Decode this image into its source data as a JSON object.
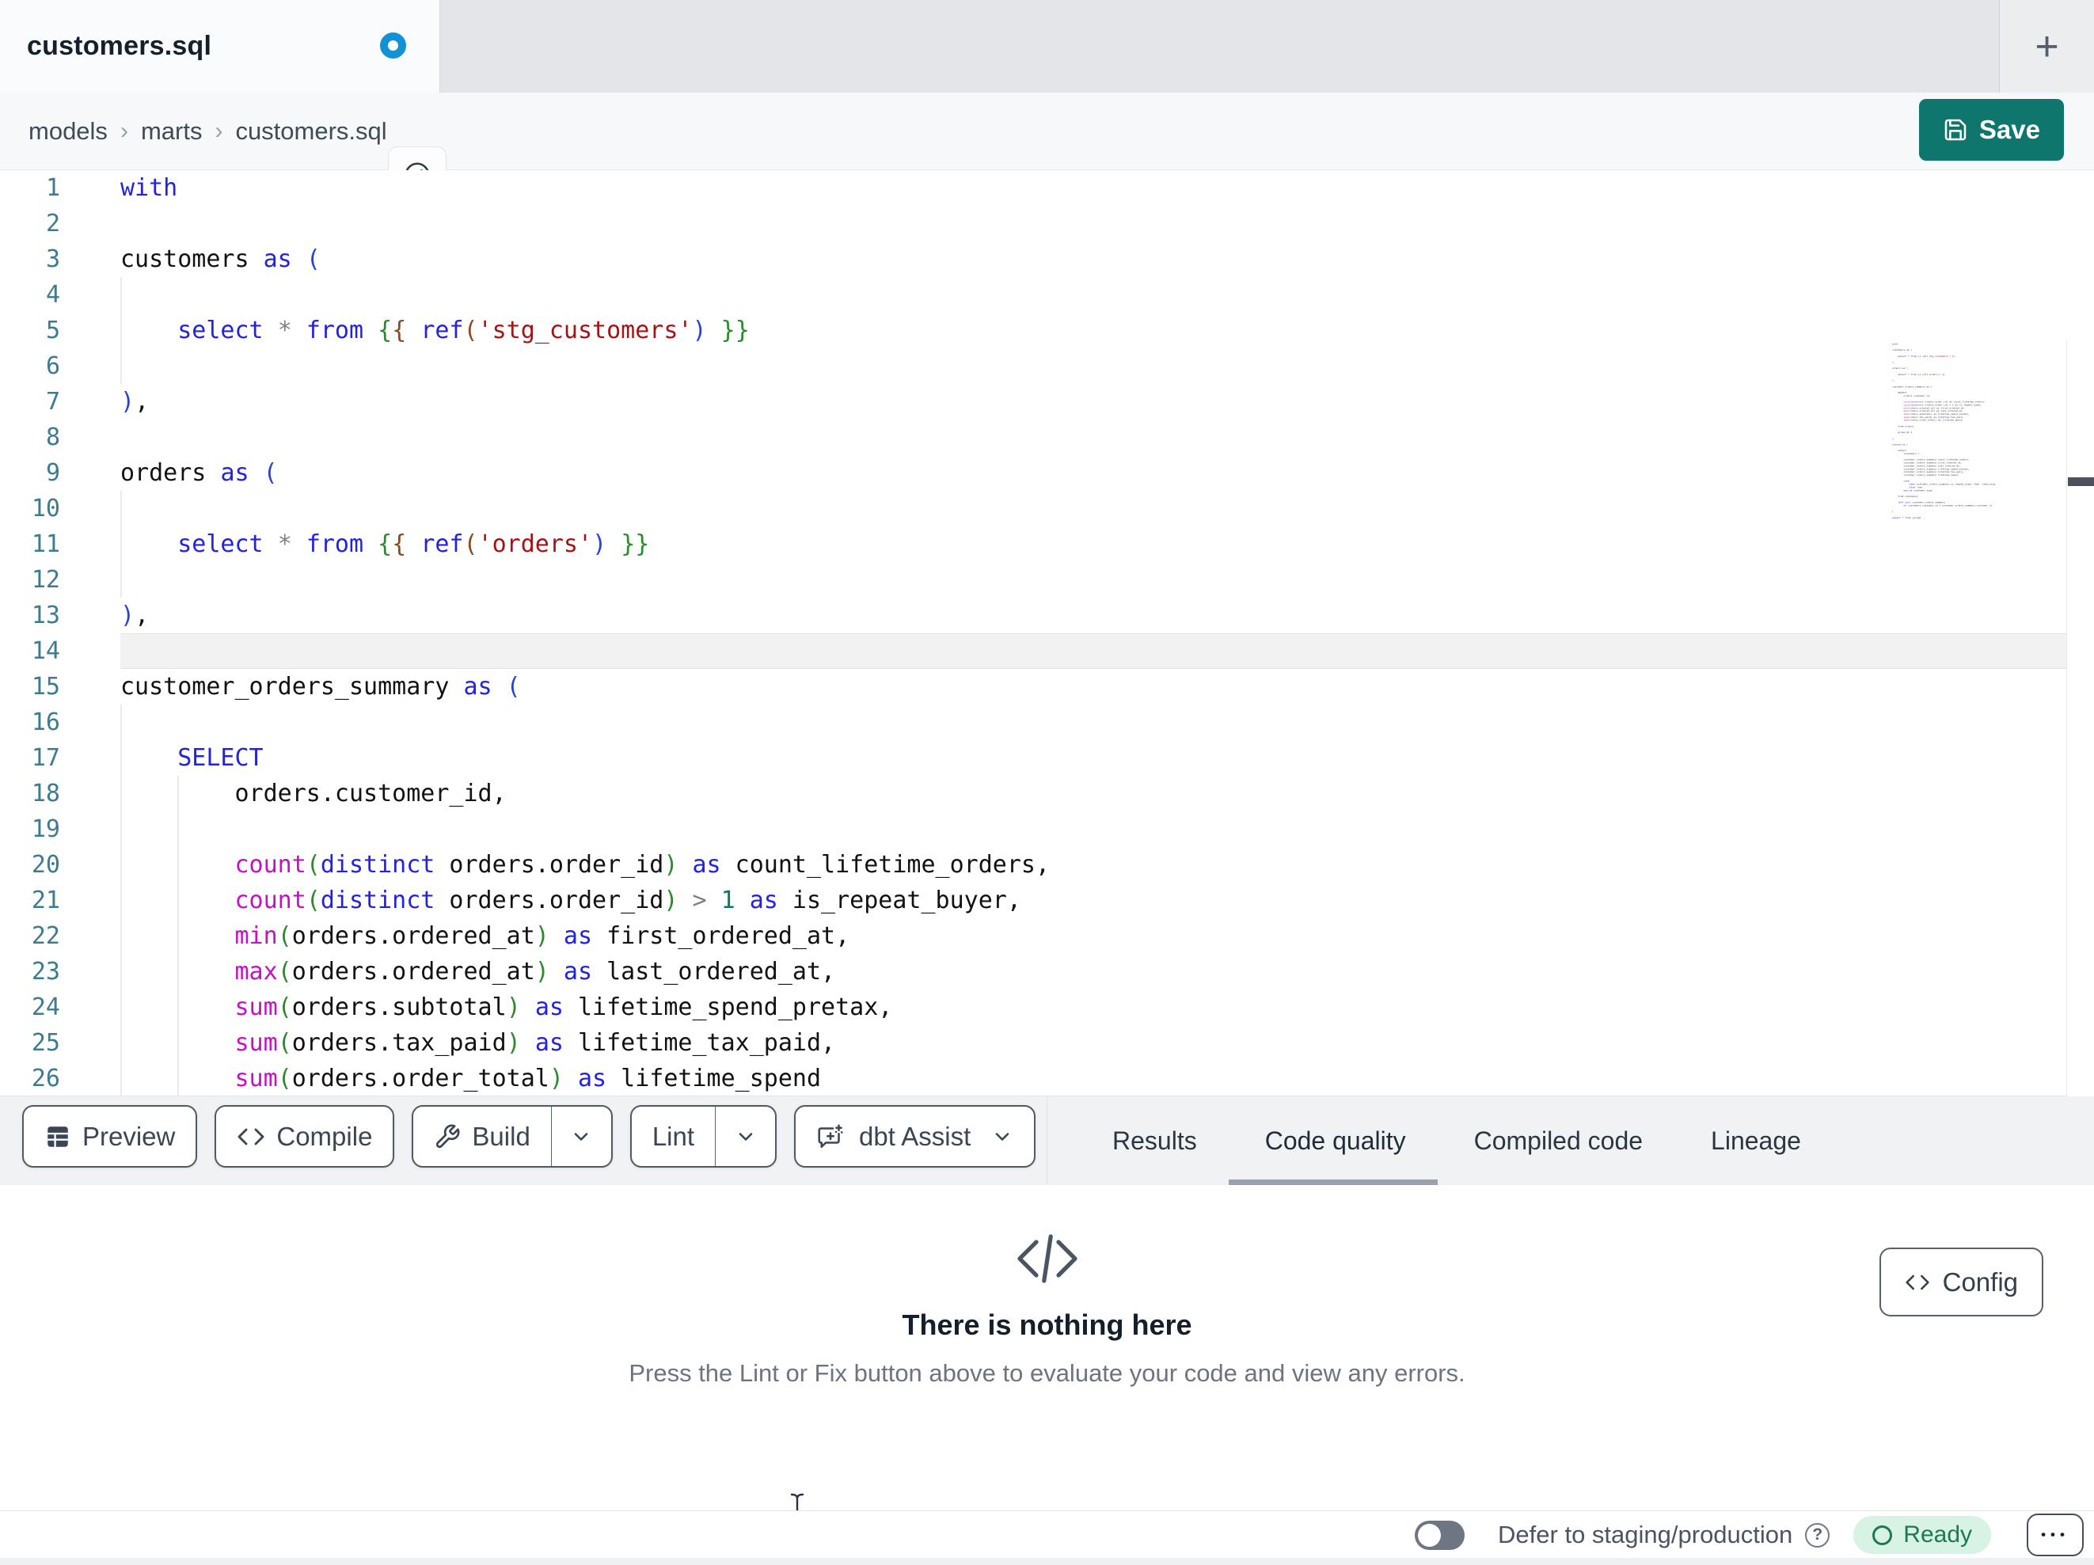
{
  "tab": {
    "title": "customers.sql",
    "new_tab_label": "+"
  },
  "breadcrumb": {
    "items": [
      "models",
      "marts",
      "customers.sql"
    ],
    "separator": "›"
  },
  "save": {
    "label": "Save"
  },
  "colors": {
    "brand_teal": "#0e766c",
    "dirty_dot_blue": "#1292d4",
    "ready_green": "#1b7a50",
    "ready_badge_bg": "#d8f2e4",
    "active_tab_underline": "#9aa1ab",
    "line_number_teal": "#3d7b8f",
    "keyword_blue": "#2323dd",
    "function_magenta": "#c511c5",
    "string_red": "#a31515"
  },
  "icons": {
    "tab_dirty": "unsaved-dot",
    "breadcrumb_action": "compass-icon",
    "save": "floppy-disk-icon",
    "preview": "table-icon",
    "compile": "code-icon",
    "build": "wrench-icon",
    "assist": "chat-plus-sparkle-icon",
    "dropdown": "chevron-down-icon",
    "empty_state": "code-icon",
    "config": "code-icon",
    "help": "question-circle-icon",
    "menu": "ellipsis-icon",
    "mouse": "text-cursor-icon"
  },
  "editor": {
    "active_line": 14,
    "lines": [
      {
        "n": "1",
        "g": [],
        "tk": [
          [
            "with",
            "kw"
          ]
        ]
      },
      {
        "n": "2",
        "g": [],
        "tk": []
      },
      {
        "n": "3",
        "g": [],
        "tk": [
          [
            "customers ",
            ""
          ],
          [
            "as",
            "kw"
          ],
          [
            " ",
            ""
          ],
          [
            "(",
            "lk"
          ]
        ]
      },
      {
        "n": "4",
        "g": [
          0
        ],
        "tk": []
      },
      {
        "n": "5",
        "g": [
          0
        ],
        "tk": [
          [
            "    ",
            ""
          ],
          [
            "select",
            "kw"
          ],
          [
            " ",
            ""
          ],
          [
            "*",
            "op"
          ],
          [
            " ",
            ""
          ],
          [
            "from",
            "kw"
          ],
          [
            " ",
            ""
          ],
          [
            "{",
            "gk"
          ],
          [
            "{",
            "bk"
          ],
          [
            " ",
            ""
          ],
          [
            "ref",
            "kw"
          ],
          [
            "(",
            "bk"
          ],
          [
            "'stg_customers'",
            "str"
          ],
          [
            ")",
            "lk"
          ],
          [
            " ",
            ""
          ],
          [
            "}",
            "gk"
          ],
          [
            "}",
            "gk"
          ]
        ]
      },
      {
        "n": "6",
        "g": [
          0
        ],
        "tk": []
      },
      {
        "n": "7",
        "g": [],
        "tk": [
          [
            ")",
            "lk"
          ],
          [
            ",",
            ""
          ]
        ]
      },
      {
        "n": "8",
        "g": [],
        "tk": []
      },
      {
        "n": "9",
        "g": [],
        "tk": [
          [
            "orders ",
            ""
          ],
          [
            "as",
            "kw"
          ],
          [
            " ",
            ""
          ],
          [
            "(",
            "lk"
          ]
        ]
      },
      {
        "n": "10",
        "g": [
          0
        ],
        "tk": []
      },
      {
        "n": "11",
        "g": [
          0
        ],
        "tk": [
          [
            "    ",
            ""
          ],
          [
            "select",
            "kw"
          ],
          [
            " ",
            ""
          ],
          [
            "*",
            "op"
          ],
          [
            " ",
            ""
          ],
          [
            "from",
            "kw"
          ],
          [
            " ",
            ""
          ],
          [
            "{",
            "gk"
          ],
          [
            "{",
            "bk"
          ],
          [
            " ",
            ""
          ],
          [
            "ref",
            "kw"
          ],
          [
            "(",
            "bk"
          ],
          [
            "'orders'",
            "str"
          ],
          [
            ")",
            "lk"
          ],
          [
            " ",
            ""
          ],
          [
            "}",
            "gk"
          ],
          [
            "}",
            "gk"
          ]
        ]
      },
      {
        "n": "12",
        "g": [
          0
        ],
        "tk": []
      },
      {
        "n": "13",
        "g": [],
        "tk": [
          [
            ")",
            "lk"
          ],
          [
            ",",
            ""
          ]
        ]
      },
      {
        "n": "14",
        "g": [],
        "tk": []
      },
      {
        "n": "15",
        "g": [],
        "tk": [
          [
            "customer_orders_summary ",
            ""
          ],
          [
            "as",
            "kw"
          ],
          [
            " ",
            ""
          ],
          [
            "(",
            "lk"
          ]
        ]
      },
      {
        "n": "16",
        "g": [
          0
        ],
        "tk": []
      },
      {
        "n": "17",
        "g": [
          0
        ],
        "tk": [
          [
            "    ",
            ""
          ],
          [
            "SELECT",
            "kw"
          ]
        ]
      },
      {
        "n": "18",
        "g": [
          0,
          4
        ],
        "tk": [
          [
            "        orders.customer_id,",
            ""
          ]
        ]
      },
      {
        "n": "19",
        "g": [
          0,
          4
        ],
        "tk": []
      },
      {
        "n": "20",
        "g": [
          0,
          4
        ],
        "tk": [
          [
            "        ",
            ""
          ],
          [
            "count",
            "fn"
          ],
          [
            "(",
            "gk"
          ],
          [
            "distinct",
            "kw"
          ],
          [
            " orders.order_id",
            ""
          ],
          [
            ")",
            "gk"
          ],
          [
            " ",
            ""
          ],
          [
            "as",
            "kw"
          ],
          [
            " count_lifetime_orders,",
            ""
          ]
        ]
      },
      {
        "n": "21",
        "g": [
          0,
          4
        ],
        "tk": [
          [
            "        ",
            ""
          ],
          [
            "count",
            "fn"
          ],
          [
            "(",
            "gk"
          ],
          [
            "distinct",
            "kw"
          ],
          [
            " orders.order_id",
            ""
          ],
          [
            ")",
            "gk"
          ],
          [
            " ",
            ""
          ],
          [
            ">",
            "op"
          ],
          [
            " ",
            ""
          ],
          [
            "1",
            "num"
          ],
          [
            " ",
            ""
          ],
          [
            "as",
            "kw"
          ],
          [
            " is_repeat_buyer,",
            ""
          ]
        ]
      },
      {
        "n": "22",
        "g": [
          0,
          4
        ],
        "tk": [
          [
            "        ",
            ""
          ],
          [
            "min",
            "fn"
          ],
          [
            "(",
            "gk"
          ],
          [
            "orders.ordered_at",
            ""
          ],
          [
            ")",
            "gk"
          ],
          [
            " ",
            ""
          ],
          [
            "as",
            "kw"
          ],
          [
            " first_ordered_at,",
            ""
          ]
        ]
      },
      {
        "n": "23",
        "g": [
          0,
          4
        ],
        "tk": [
          [
            "        ",
            ""
          ],
          [
            "max",
            "fn"
          ],
          [
            "(",
            "gk"
          ],
          [
            "orders.ordered_at",
            ""
          ],
          [
            ")",
            "gk"
          ],
          [
            " ",
            ""
          ],
          [
            "as",
            "kw"
          ],
          [
            " last_ordered_at,",
            ""
          ]
        ]
      },
      {
        "n": "24",
        "g": [
          0,
          4
        ],
        "tk": [
          [
            "        ",
            ""
          ],
          [
            "sum",
            "fn"
          ],
          [
            "(",
            "gk"
          ],
          [
            "orders.subtotal",
            ""
          ],
          [
            ")",
            "gk"
          ],
          [
            " ",
            ""
          ],
          [
            "as",
            "kw"
          ],
          [
            " lifetime_spend_pretax,",
            ""
          ]
        ]
      },
      {
        "n": "25",
        "g": [
          0,
          4
        ],
        "tk": [
          [
            "        ",
            ""
          ],
          [
            "sum",
            "fn"
          ],
          [
            "(",
            "gk"
          ],
          [
            "orders.tax_paid",
            ""
          ],
          [
            ")",
            "gk"
          ],
          [
            " ",
            ""
          ],
          [
            "as",
            "kw"
          ],
          [
            " lifetime_tax_paid,",
            ""
          ]
        ]
      },
      {
        "n": "26",
        "g": [
          0,
          4
        ],
        "tk": [
          [
            "        ",
            ""
          ],
          [
            "sum",
            "fn"
          ],
          [
            "(",
            "gk"
          ],
          [
            "orders.order_total",
            ""
          ],
          [
            ")",
            "gk"
          ],
          [
            " ",
            ""
          ],
          [
            "as",
            "kw"
          ],
          [
            " lifetime_spend",
            ""
          ]
        ]
      }
    ]
  },
  "minimap": {
    "code": [
      "with",
      "",
      "customers as (",
      "",
      "    select * from {{ ref('stg_customers') }}",
      "",
      "),",
      "",
      "orders as (",
      "",
      "    select * from {{ ref('orders') }}",
      "",
      "),",
      "",
      "customer_orders_summary as (",
      "",
      "    SELECT",
      "        orders.customer_id,",
      "",
      "        count(distinct orders.order_id) as count_lifetime_orders,",
      "        count(distinct orders.order_id) > 1 as is_repeat_buyer,",
      "        min(orders.ordered_at) as first_ordered_at,",
      "        max(orders.ordered_at) as last_ordered_at,",
      "        sum(orders.subtotal) as lifetime_spend_pretax,",
      "        sum(orders.tax_paid) as lifetime_tax_paid,",
      "        sum(orders.order_total) as lifetime_spend",
      "",
      "    from orders",
      "",
      "    group by 1",
      "",
      "),",
      "",
      "joined as (",
      "",
      "    select",
      "        customers.*,",
      "",
      "        customer_orders_summary.count_lifetime_orders,",
      "        customer_orders_summary.first_ordered_at,",
      "        customer_orders_summary.last_ordered_at,",
      "        customer_orders_summary.lifetime_spend_pretax,",
      "        customer_orders_summary.lifetime_tax_paid,",
      "        customer_orders_summary.lifetime_spend,",
      "",
      "        case",
      "            when customer_orders_summary.is_repeat_buyer then 'returning'",
      "            else 'new'",
      "        end as customer_type",
      "",
      "    from customers",
      "",
      "    left join customer_orders_summary",
      "        on customers.customer_id = customer_orders_summary.customer_id",
      "",
      ")",
      "",
      "select * from joined"
    ]
  },
  "toolbar": {
    "buttons": [
      {
        "label": "Preview",
        "icon": "table-icon"
      },
      {
        "label": "Compile",
        "icon": "code-icon"
      },
      {
        "label": "Build",
        "icon": "wrench-icon",
        "split": true
      },
      {
        "label": "Lint",
        "split": true
      },
      {
        "label": "dbt Assist",
        "icon": "chat-plus-sparkle-icon",
        "chevron": true
      }
    ]
  },
  "panel_tabs": [
    {
      "label": "Results",
      "active": false
    },
    {
      "label": "Code quality",
      "active": true
    },
    {
      "label": "Compiled code",
      "active": false
    },
    {
      "label": "Lineage",
      "active": false
    }
  ],
  "empty_state": {
    "title": "There is nothing here",
    "subtitle": "Press the Lint or Fix button above to evaluate your code and view any errors.",
    "config_label": "Config"
  },
  "status_bar": {
    "defer_label": "Defer to staging/production",
    "help_label": "?",
    "ready_label": "Ready",
    "menu_label": "•••"
  }
}
